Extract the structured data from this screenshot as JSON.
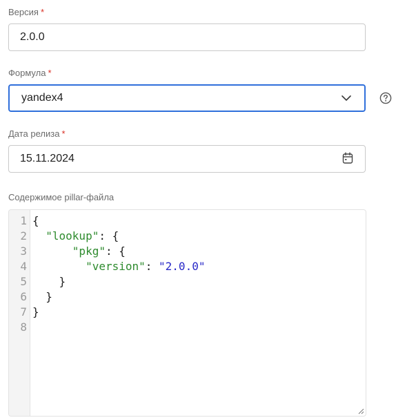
{
  "fields": {
    "version": {
      "label": "Версия",
      "required_mark": "*",
      "value": "2.0.0"
    },
    "formula": {
      "label": "Формула",
      "required_mark": "*",
      "value": "yandex4",
      "icon": "chevron-down-icon",
      "help_icon": "help-icon"
    },
    "release_date": {
      "label": "Дата релиза",
      "required_mark": "*",
      "value": "15.11.2024",
      "icon": "calendar-icon"
    },
    "pillar": {
      "label": "Содержимое pillar-файла",
      "line_numbers": [
        "1",
        "2",
        "3",
        "4",
        "5",
        "6",
        "7",
        "8"
      ],
      "lines": [
        {
          "indent": "",
          "key": "",
          "sep": "",
          "value": "",
          "tail": "{"
        },
        {
          "indent": "  ",
          "key": "\"lookup\"",
          "sep": ": ",
          "value": "",
          "tail": "{"
        },
        {
          "indent": "      ",
          "key": "\"pkg\"",
          "sep": ": ",
          "value": "",
          "tail": "{"
        },
        {
          "indent": "        ",
          "key": "\"version\"",
          "sep": ": ",
          "value": "\"2.0.0\"",
          "tail": ""
        },
        {
          "indent": "    ",
          "key": "",
          "sep": "",
          "value": "",
          "tail": "}"
        },
        {
          "indent": "  ",
          "key": "",
          "sep": "",
          "value": "",
          "tail": "}"
        },
        {
          "indent": "",
          "key": "",
          "sep": "",
          "value": "",
          "tail": "}"
        },
        {
          "indent": "",
          "key": "",
          "sep": "",
          "value": "",
          "tail": ""
        }
      ]
    }
  },
  "colors": {
    "focus_border": "#2f6fdb",
    "required": "#d93025",
    "json_key": "#2e8b2e",
    "json_string": "#2828c8"
  }
}
